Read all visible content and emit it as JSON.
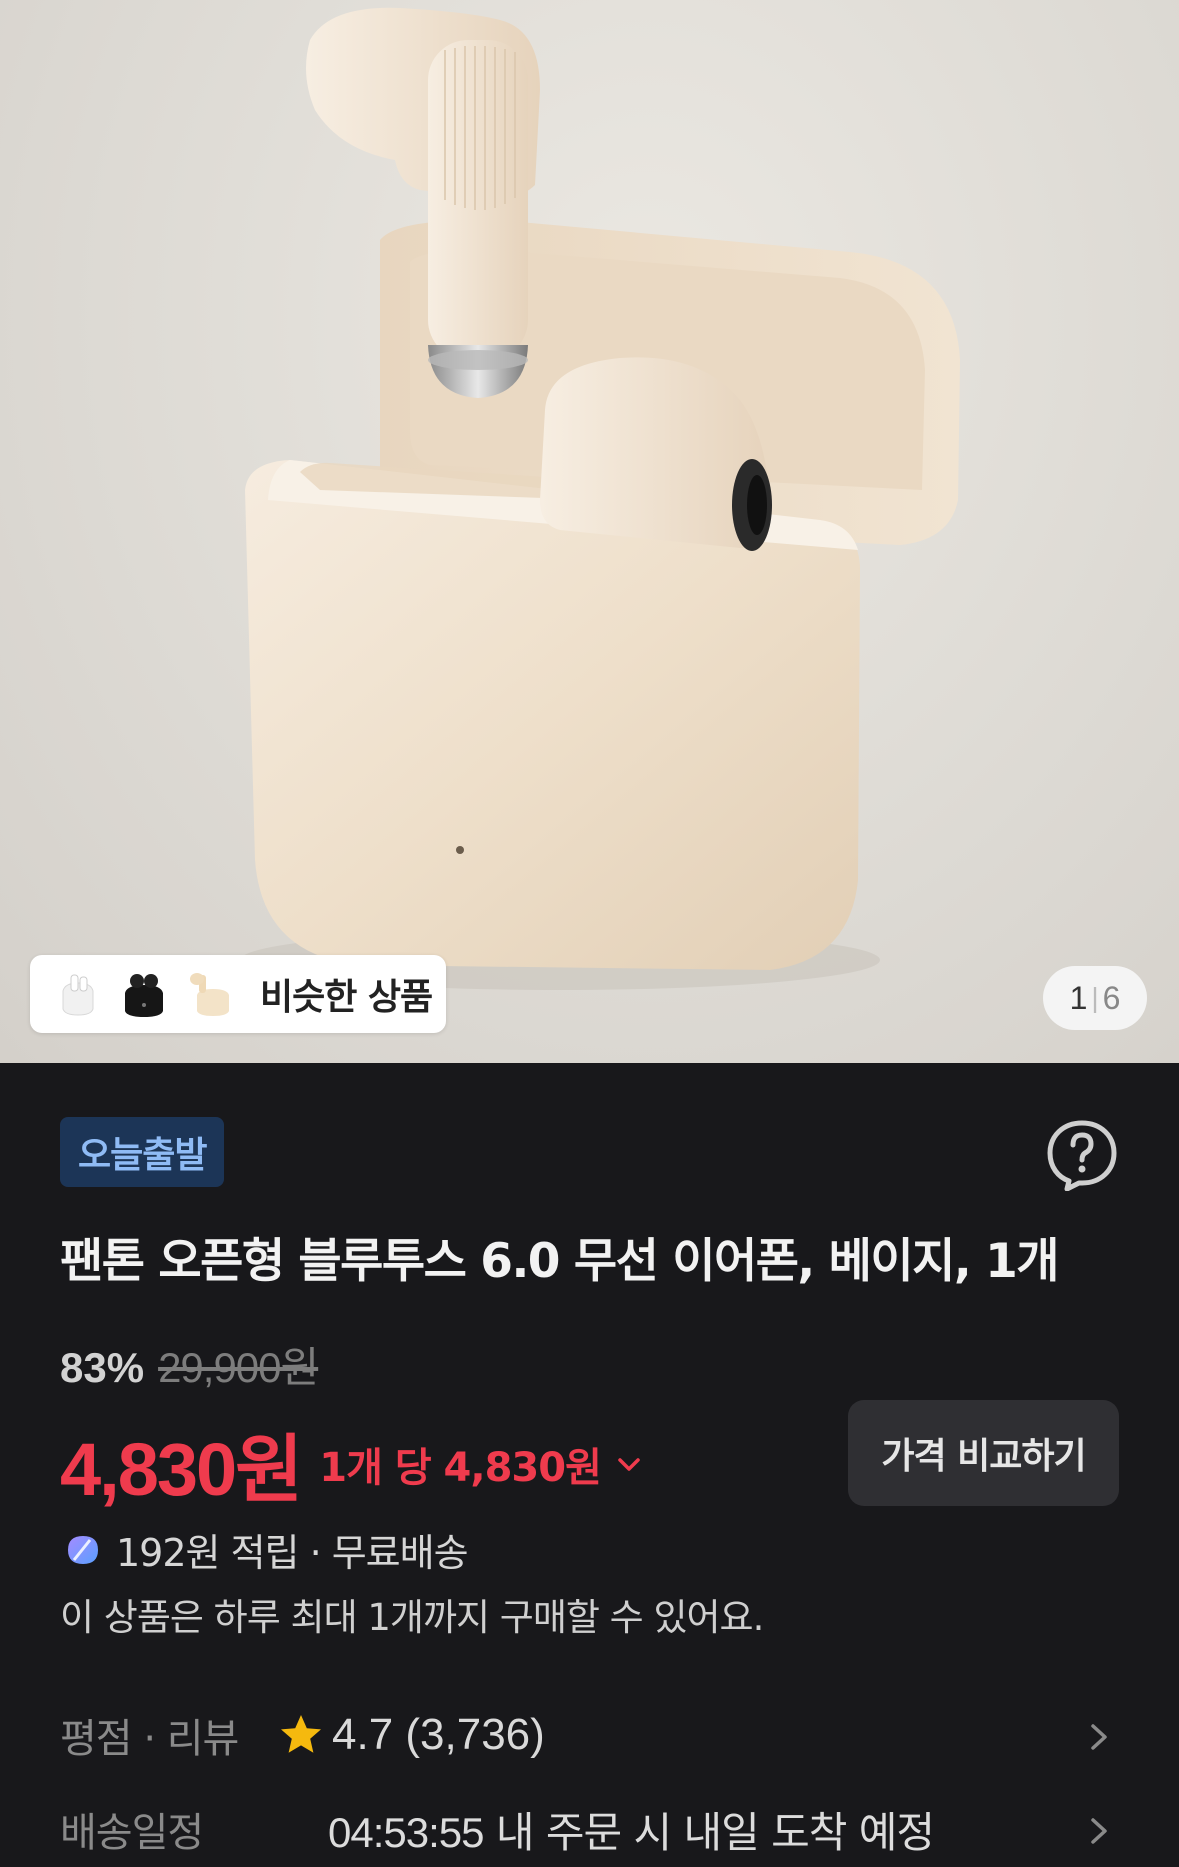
{
  "gallery": {
    "similar_label": "비슷한 상품",
    "similar_thumbs": [
      "white-earbuds-thumb",
      "black-earbuds-thumb",
      "beige-earbuds-thumb"
    ],
    "current_index": "1",
    "total": "6"
  },
  "product": {
    "badge": "오늘출발",
    "title": "팬톤 오픈형 블루투스 6.0 무선 이어폰, 베이지, 1개",
    "discount_rate": "83%",
    "original_price": "29,900원",
    "sale_price": "4,830원",
    "unit_price": "1개 당 4,830원",
    "compare_button": "가격 비교하기",
    "points": "192원 적립 · 무료배송",
    "purchase_limit": "이 상품은 하루 최대 1개까지 구매할 수 있어요."
  },
  "rating": {
    "label": "평점 · 리뷰",
    "value": "4.7 (3,736)"
  },
  "delivery": {
    "label": "배송일정",
    "countdown": "04:53:55",
    "message": " 내 주문 시 내일 도착 예정"
  },
  "colors": {
    "background": "#18181b",
    "price_red": "#ef3b4d",
    "badge_bg": "#1c3557",
    "badge_text": "#8fbbf5",
    "star": "#f5b90e",
    "product_beige": "#eee0cc"
  },
  "icons": [
    "help-circle-icon",
    "chevron-down-icon",
    "coupay-points-icon",
    "star-icon",
    "chevron-right-icon"
  ]
}
